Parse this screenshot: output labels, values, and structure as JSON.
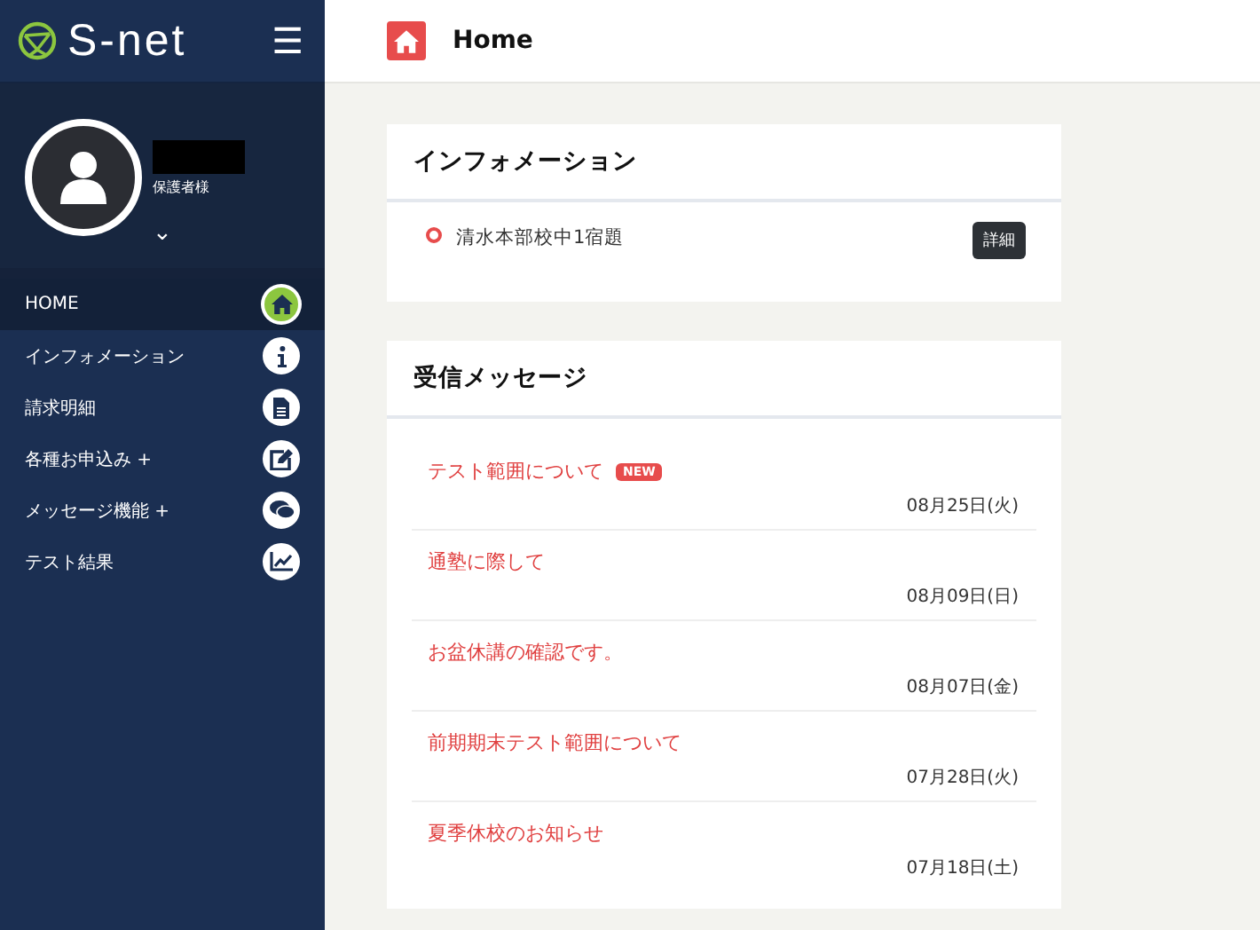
{
  "sidebar": {
    "logo": "S-net",
    "menu_icon": "☰",
    "profile": {
      "role": "保護者様",
      "expand_icon": "⌄"
    },
    "items": [
      {
        "label": "HOME",
        "selected": true
      },
      {
        "label": "インフォメーション",
        "selected": false
      },
      {
        "label": "請求明細",
        "selected": false
      },
      {
        "label": "各種お申込み +",
        "selected": false
      },
      {
        "label": "メッセージ機能 +",
        "selected": false
      },
      {
        "label": "テスト結果",
        "selected": false
      }
    ]
  },
  "header": {
    "title": "Home"
  },
  "information": {
    "title": "インフォメーション",
    "items": [
      {
        "text": "清水本部校中1宿題",
        "button": "詳細"
      }
    ]
  },
  "messages": {
    "title": "受信メッセージ",
    "items": [
      {
        "title": "テスト範囲について",
        "badge": "NEW",
        "date": "08月25日(火)"
      },
      {
        "title": "通塾に際して",
        "date": "08月09日(日)"
      },
      {
        "title": "お盆休講の確認です。",
        "date": "08月07日(金)"
      },
      {
        "title": "前期期末テスト範囲について",
        "date": "07月28日(火)"
      },
      {
        "title": "夏季休校のお知らせ",
        "date": "07月18日(土)"
      }
    ]
  }
}
